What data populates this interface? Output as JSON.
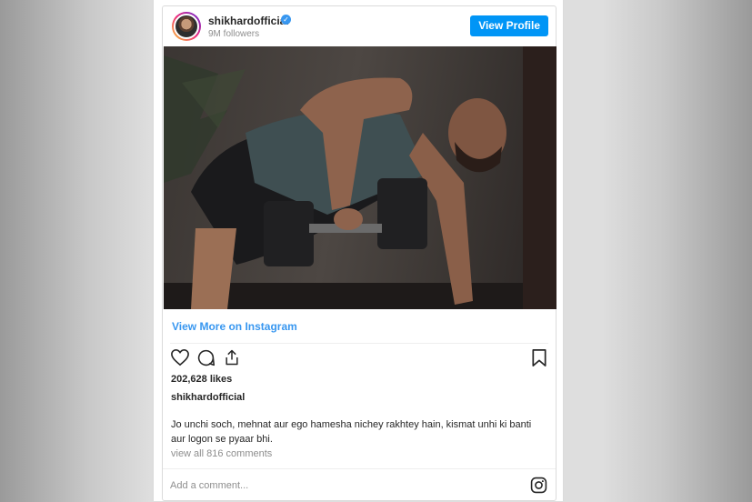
{
  "header": {
    "username": "shikhardofficial",
    "followers": "9M followers",
    "view_profile_label": "View Profile",
    "verified_glyph": "✓"
  },
  "post": {
    "view_more_label": "View More on Instagram",
    "likes": "202,628 likes",
    "caption_user": "shikhardofficial",
    "caption_text": "Jo unchi soch, mehnat aur ego hamesha nichey rakhtey hain, kismat unhi ki banti aur logon se pyaar bhi.",
    "comments_link": "view all 816 comments"
  },
  "comment_bar": {
    "placeholder": "Add a comment..."
  },
  "icons": [
    "avatar",
    "verified-badge-icon",
    "heart-icon",
    "comment-icon",
    "share-icon",
    "bookmark-icon",
    "instagram-icon"
  ],
  "colors": {
    "accent": "#0095f6",
    "link": "#3897f0",
    "text": "#262626",
    "muted": "#8e8e8e"
  }
}
